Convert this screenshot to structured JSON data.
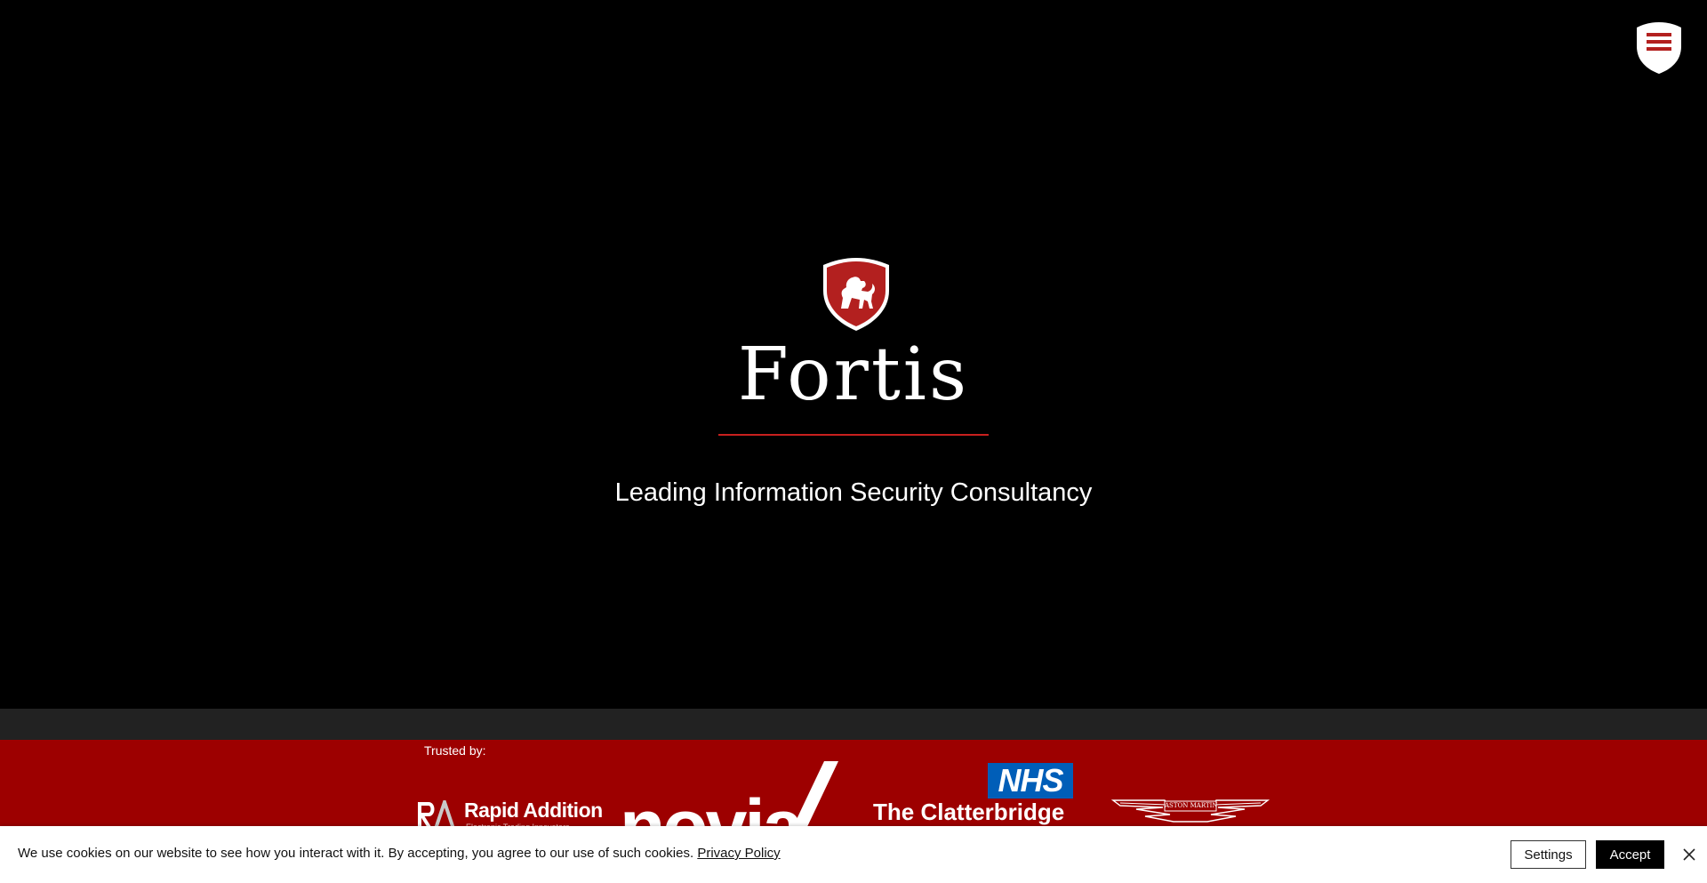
{
  "hero": {
    "brand_name": "Fortis",
    "tagline": "Leading Information Security Consultancy"
  },
  "trusted": {
    "label": "Trusted by:",
    "clients": {
      "rapid_addition": {
        "name": "Rapid Addition",
        "sub": "Electronic Trading Innovators"
      },
      "novia": {
        "name": "novia"
      },
      "nhs": {
        "badge": "NHS",
        "name": "The Clatterbridge"
      },
      "aston": {
        "name": "ASTON MARTIN"
      }
    }
  },
  "cookie": {
    "text": "We use cookies on our website to see how you interact with it. By accepting, you agree to our use of such cookies.",
    "privacy_link": "Privacy Policy",
    "settings_label": "Settings",
    "accept_label": "Accept"
  },
  "colors": {
    "brand_red": "#b3201f",
    "band_red": "#9d0000",
    "hero_bg": "#000000",
    "dark_band": "#222222",
    "nhs_blue": "#005eb8"
  }
}
